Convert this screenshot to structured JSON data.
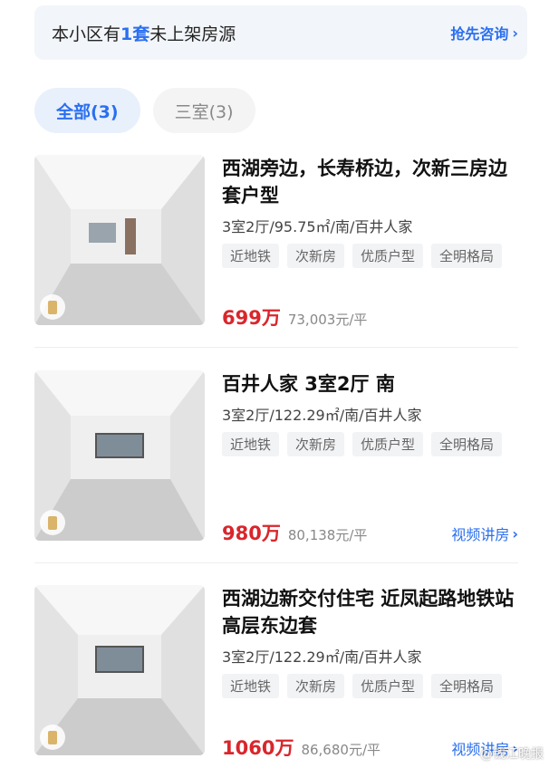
{
  "banner": {
    "prefix": "本小区有",
    "count": "1套",
    "suffix": "未上架房源",
    "link": "抢先咨询"
  },
  "filters": [
    {
      "label": "全部(3)",
      "active": true
    },
    {
      "label": "三室(3)",
      "active": false
    }
  ],
  "listings": [
    {
      "title": "西湖旁边，长寿桥边，次新三房边套户型",
      "meta": "3室2厅/95.75㎡/南/百井人家",
      "tags": [
        "近地铁",
        "次新房",
        "优质户型",
        "全明格局"
      ],
      "price": "699万",
      "unit_price": "73,003元/平",
      "video_link": ""
    },
    {
      "title": "百井人家 3室2厅 南",
      "meta": "3室2厅/122.29㎡/南/百井人家",
      "tags": [
        "近地铁",
        "次新房",
        "优质户型",
        "全明格局"
      ],
      "price": "980万",
      "unit_price": "80,138元/平",
      "video_link": "视频讲房"
    },
    {
      "title": "西湖边新交付住宅 近凤起路地铁站 高层东边套",
      "meta": "3室2厅/122.29㎡/南/百井人家",
      "tags": [
        "近地铁",
        "次新房",
        "优质户型",
        "全明格局"
      ],
      "price": "1060万",
      "unit_price": "86,680元/平",
      "video_link": "视频讲房"
    }
  ],
  "watermark": "@钱江晚报",
  "colors": {
    "accent": "#2a6ff0",
    "price": "#d9262c"
  }
}
